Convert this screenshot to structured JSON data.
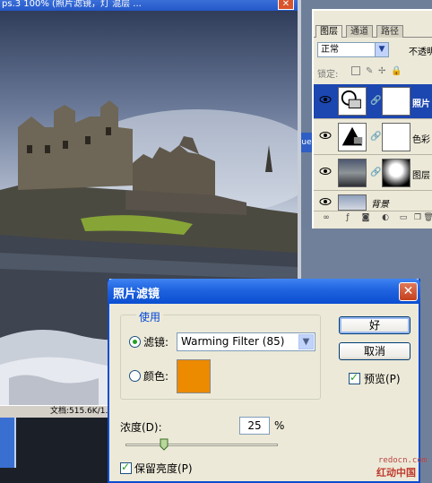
{
  "document": {
    "title": "ps.3 100% (照片滤镜，灯 混层 ...",
    "status": "文档:515.6K/1.69M"
  },
  "layers_panel": {
    "tabs": [
      {
        "label": "图层",
        "active": true
      },
      {
        "label": "通道",
        "active": false
      },
      {
        "label": "路径",
        "active": false
      }
    ],
    "blend_mode": "正常",
    "opacity_label": "不透明",
    "lock_label": "锁定:",
    "layers": [
      {
        "name": "照片",
        "selected": true
      },
      {
        "name": "色彩",
        "selected": false
      },
      {
        "name": "图层",
        "selected": false
      },
      {
        "name": "背景",
        "selected": false
      }
    ]
  },
  "dialog": {
    "title": "照片滤镜",
    "close_glyph": "✕",
    "group_label": "使用",
    "filter_label": "滤镜:",
    "filter_value": "Warming Filter (85)",
    "filter_selected": true,
    "color_label": "颜色:",
    "color_value": "#ec8a00",
    "ok_button": "好",
    "cancel_button": "取消",
    "preview_label": "预览(P)",
    "preview_checked": true,
    "density_label": "浓度(D):",
    "density_value": "25",
    "density_unit": "%",
    "density_fraction": 0.25,
    "preserve_label": "保留亮度(P)",
    "preserve_checked": true
  },
  "watermark": {
    "url": "redocn.com",
    "site": "红动中国"
  },
  "colors": {
    "accent": "#0a4fd0",
    "swatch": "#ec8a00"
  }
}
